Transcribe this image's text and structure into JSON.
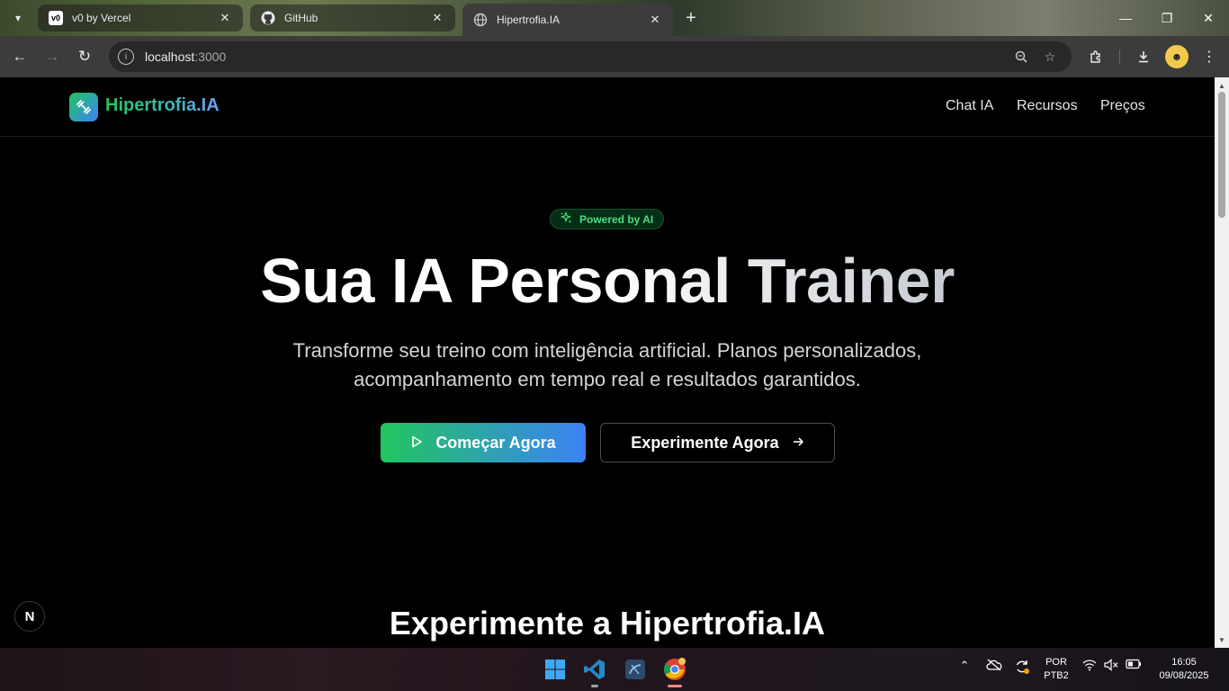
{
  "browser": {
    "tabs": [
      {
        "title": "v0 by Vercel",
        "favicon": "v0-logo-icon",
        "active": false
      },
      {
        "title": "GitHub",
        "favicon": "github-icon",
        "active": false
      },
      {
        "title": "Hipertrofia.IA",
        "favicon": "globe-icon",
        "active": true
      }
    ],
    "url_host": "localhost",
    "url_port": ":3000"
  },
  "site": {
    "brand": "Hipertrofia.IA",
    "nav": [
      "Chat IA",
      "Recursos",
      "Preços"
    ],
    "badge": "Powered by AI",
    "hero_title": "Sua IA Personal Trainer",
    "hero_subtitle": "Transforme seu treino com inteligência artificial. Planos personalizados, acompanhamento em tempo real e resultados garantidos.",
    "primary_button": "Começar Agora",
    "secondary_button": "Experimente Agora",
    "section_title": "Experimente a Hipertrofia.IA",
    "next_indicator": "N"
  },
  "taskbar": {
    "language": "POR",
    "layout": "PTB2",
    "time": "16:05",
    "date": "09/08/2025"
  },
  "colors": {
    "accent_green": "#22c55e",
    "accent_blue": "#3b82f6",
    "badge_text": "#4ade80"
  }
}
